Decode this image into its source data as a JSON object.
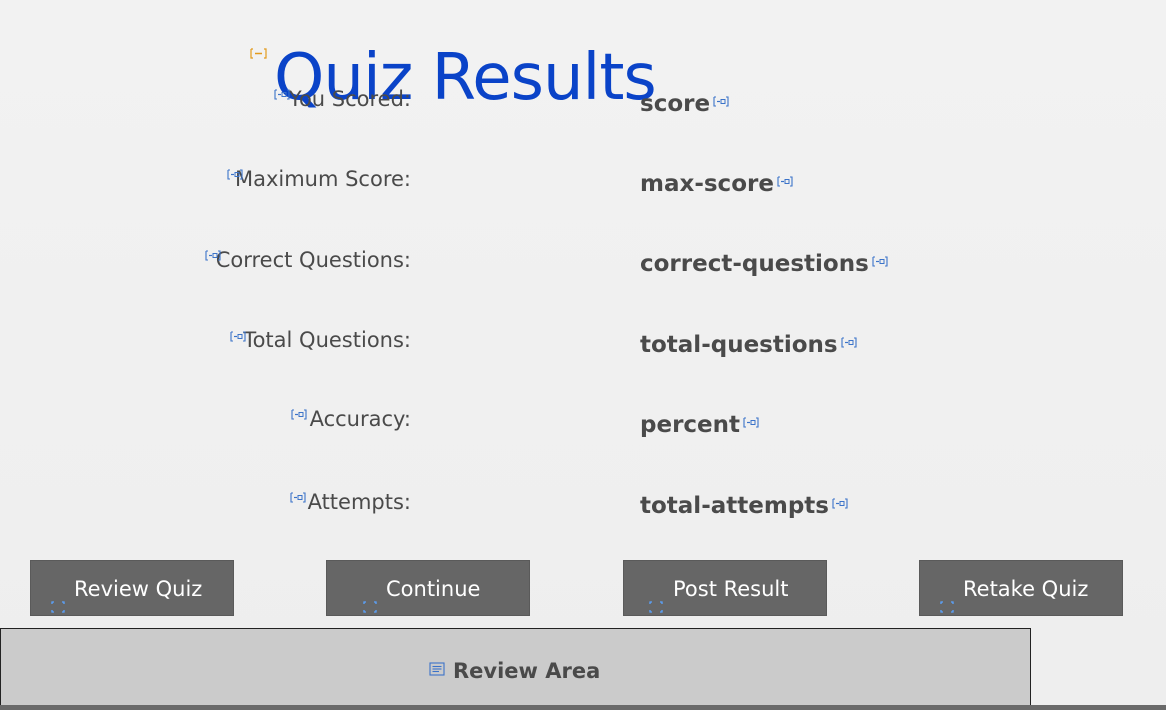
{
  "page": {
    "title": "Quiz Results"
  },
  "results": [
    {
      "key": "score",
      "label": "You Scored:",
      "value": "score"
    },
    {
      "key": "max_score",
      "label": "Maximum Score:",
      "value": "max-score"
    },
    {
      "key": "correct",
      "label": "Correct Questions:",
      "value": "correct-questions"
    },
    {
      "key": "total",
      "label": "Total Questions:",
      "value": "total-questions"
    },
    {
      "key": "accuracy",
      "label": "Accuracy:",
      "value": "percent"
    },
    {
      "key": "attempts",
      "label": "Attempts:",
      "value": "total-attempts"
    }
  ],
  "buttons": {
    "review_quiz": "Review Quiz",
    "continue": "Continue",
    "post_result": "Post Result",
    "retake_quiz": "Retake Quiz"
  },
  "review_area": {
    "label": "Review Area"
  },
  "icons": {
    "variable_placeholder": "variable-placeholder-icon",
    "button_marker": "expand-icon",
    "review_area": "review-area-icon",
    "title_marker": "collapse-icon"
  },
  "colors": {
    "title": "#0a43c8",
    "text": "#4a4a4a",
    "button_bg": "#666666",
    "button_text": "#ffffff",
    "review_area_bg": "#cbcbcb",
    "icon_blue": "#3b73c9",
    "icon_orange": "#e39b1e"
  }
}
